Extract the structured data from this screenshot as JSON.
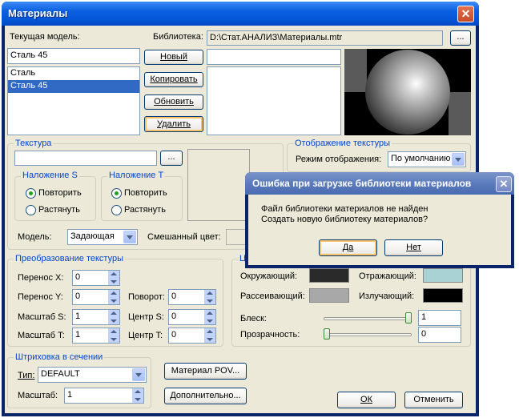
{
  "window": {
    "title": "Материалы"
  },
  "current_model": {
    "label": "Текущая модель:",
    "value": "Сталь 45",
    "list": [
      "Сталь",
      "Сталь 45"
    ],
    "selected_index": 1
  },
  "library": {
    "label": "Библиотека:",
    "path": "D:\\Стат.АНАЛИЗ\\Материалы.mtr",
    "browse": "..."
  },
  "actions": {
    "new": "Новый",
    "copy": "Копировать",
    "update": "Обновить",
    "delete": "Удалить"
  },
  "texture": {
    "group_title": "Текстура",
    "browse": "...",
    "overlay_s": {
      "title": "Наложение S",
      "repeat": "Повторить",
      "stretch": "Растянуть",
      "selected": "repeat"
    },
    "overlay_t": {
      "title": "Наложение T",
      "repeat": "Повторить",
      "stretch": "Растянуть",
      "selected": "repeat"
    },
    "model_label": "Модель:",
    "model_value": "Задающая",
    "mixed_color_label": "Смешанный цвет:"
  },
  "texture_display": {
    "group_title": "Отображение текстуры",
    "mode_label": "Режим отображения:",
    "mode_value": "По умолчанию"
  },
  "transform": {
    "group_title": "Преобразование текстуры",
    "shift_x_label": "Перенос X:",
    "shift_x": "0",
    "shift_y_label": "Перенос Y:",
    "shift_y": "0",
    "scale_s_label": "Масштаб S:",
    "scale_s": "1",
    "scale_t_label": "Масштаб T:",
    "scale_t": "1",
    "rotate_label": "Поворот:",
    "rotate": "0",
    "center_s_label": "Центр S:",
    "center_s": "0",
    "center_t_label": "Центр T:",
    "center_t": "0"
  },
  "colors": {
    "group_title": "Ц",
    "ambient_label": "Окружающий:",
    "ambient_color": "#2a2a2a",
    "reflective_label": "Отражающий:",
    "reflective_color": "#a9d2d4",
    "diffuse_label": "Рассеивающий:",
    "diffuse_color": "#a8a8a8",
    "emissive_label": "Излучающий:",
    "emissive_color": "#000000",
    "shine_label": "Блеск:",
    "shine_value": "1",
    "shine_level": 1.0,
    "transparency_label": "Прозрачность:",
    "transparency_value": "0",
    "transparency_level": 0.0
  },
  "hatch": {
    "group_title": "Штриховка в сечении",
    "type_label": "Тип:",
    "type_value": "DEFAULT",
    "scale_label": "Масштаб:",
    "scale_value": "1"
  },
  "bottom": {
    "pov_button": "Материал POV...",
    "more_button": "Дополнительно...",
    "ok": "ОК",
    "cancel": "Отменить"
  },
  "error_dialog": {
    "title": "Ошибка при загрузке  библиотеки материалов",
    "line1": "Файл библиотеки материалов не найден",
    "line2": "Создать новую библиотеку материалов?",
    "yes": "Да",
    "no": "Нет"
  }
}
